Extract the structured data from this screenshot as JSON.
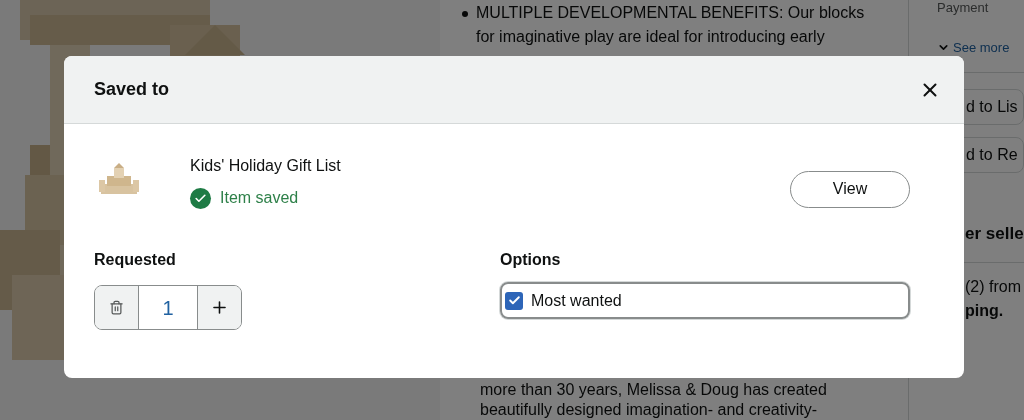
{
  "background": {
    "bullet": {
      "lines": [
        "MULTIPLE DEVELOPMENTAL BENEFITS: Our blocks",
        "for imaginative play are ideal for introducing early"
      ]
    },
    "paragraph": {
      "lines": [
        "more than 30 years, Melissa & Doug has created",
        "beautifully designed imagination- and creativity-"
      ]
    },
    "sidebar": {
      "payment": "Payment",
      "see_more": "See more",
      "buttons": [
        "d to Lis",
        "d to Re"
      ],
      "seller_heading": "er selle",
      "offer_lines": [
        "(2) from",
        "ping."
      ]
    }
  },
  "dialog": {
    "title": "Saved to",
    "list_name": "Kids' Holiday Gift List",
    "status": "Item saved",
    "view_button": "View",
    "requested": {
      "label": "Requested",
      "quantity": "1"
    },
    "options": {
      "label": "Options",
      "items": [
        {
          "label": "Most wanted",
          "checked": true
        }
      ]
    }
  }
}
